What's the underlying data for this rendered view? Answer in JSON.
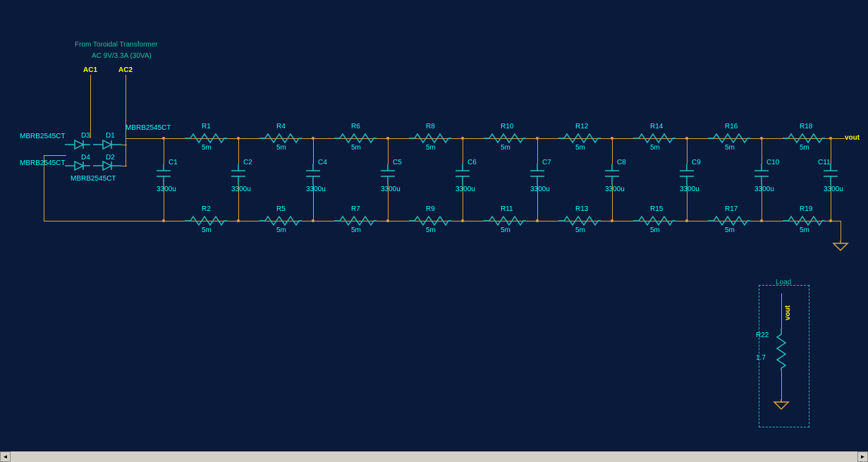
{
  "annotations": {
    "source_title": "From Toroidal Transformer",
    "source_spec": "AC 9V/3.3A (30VA)",
    "ac1": "AC1",
    "ac2": "AC2",
    "vout": "vout",
    "load_title": "Load",
    "load_vout": "vout"
  },
  "diodes": {
    "d1": {
      "ref": "D1",
      "model": "MBRB2545CT"
    },
    "d2": {
      "ref": "D2",
      "model": "MBRB2545CT"
    },
    "d3": {
      "ref": "D3",
      "model": "MBRB2545CT"
    },
    "d4": {
      "ref": "D4",
      "model": "MBRB2545CT"
    }
  },
  "resistors_top": [
    {
      "ref": "R1",
      "val": "5m"
    },
    {
      "ref": "R4",
      "val": "5m"
    },
    {
      "ref": "R6",
      "val": "5m"
    },
    {
      "ref": "R8",
      "val": "5m"
    },
    {
      "ref": "R10",
      "val": "5m"
    },
    {
      "ref": "R12",
      "val": "5m"
    },
    {
      "ref": "R14",
      "val": "5m"
    },
    {
      "ref": "R16",
      "val": "5m"
    },
    {
      "ref": "R18",
      "val": "5m"
    }
  ],
  "resistors_bot": [
    {
      "ref": "R2",
      "val": "5m"
    },
    {
      "ref": "R5",
      "val": "5m"
    },
    {
      "ref": "R7",
      "val": "5m"
    },
    {
      "ref": "R9",
      "val": "5m"
    },
    {
      "ref": "R11",
      "val": "5m"
    },
    {
      "ref": "R13",
      "val": "5m"
    },
    {
      "ref": "R15",
      "val": "5m"
    },
    {
      "ref": "R17",
      "val": "5m"
    },
    {
      "ref": "R19",
      "val": "5m"
    }
  ],
  "caps": [
    {
      "ref": "C1",
      "val": "3300u"
    },
    {
      "ref": "C2",
      "val": "3300u"
    },
    {
      "ref": "C4",
      "val": "3300u"
    },
    {
      "ref": "C5",
      "val": "3300u"
    },
    {
      "ref": "C6",
      "val": "3300u"
    },
    {
      "ref": "C7",
      "val": "3300u"
    },
    {
      "ref": "C8",
      "val": "3300u"
    },
    {
      "ref": "C9",
      "val": "3300u"
    },
    {
      "ref": "C10",
      "val": "3300u"
    },
    {
      "ref": "C11",
      "val": "3300u"
    }
  ],
  "load_r": {
    "ref": "R22",
    "val": "1.7"
  }
}
